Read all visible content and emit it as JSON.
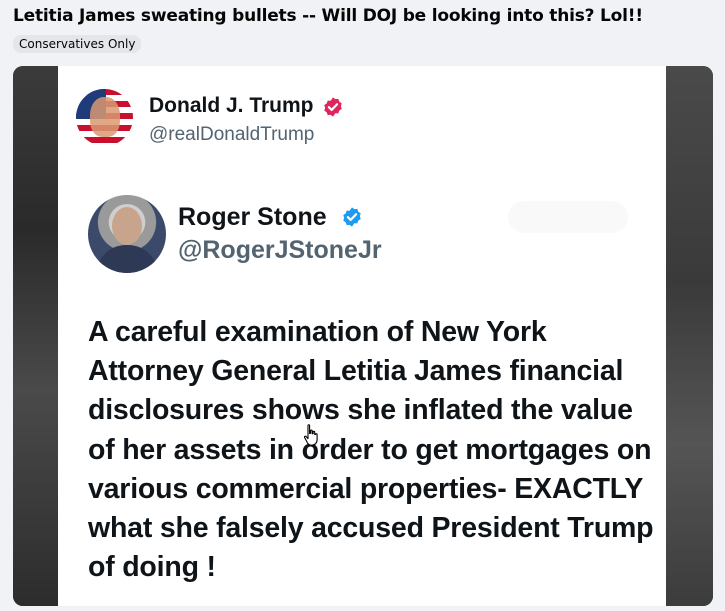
{
  "post": {
    "title": "Letitia James sweating bullets -- Will DOJ be looking into this? Lol!!",
    "tag": "Conservatives Only"
  },
  "image": {
    "outer_tweet": {
      "name": "Donald J. Trump",
      "handle": "@realDonaldTrump",
      "verified_badge_color": "#e0245e"
    },
    "inner_tweet": {
      "name": "Roger Stone",
      "handle": "@RogerJStoneJr",
      "verified_badge_color": "#1d9bf0",
      "text": "A careful examination of New York Attorney General Letitia James financial disclosures shows she inflated the value of her assets in order to get mortgages on various commercial properties- EXACTLY what she falsely accused President Trump of doing !"
    }
  },
  "icons": {
    "cursor": "hand-pointer-icon",
    "verified": "verified-badge-icon"
  }
}
